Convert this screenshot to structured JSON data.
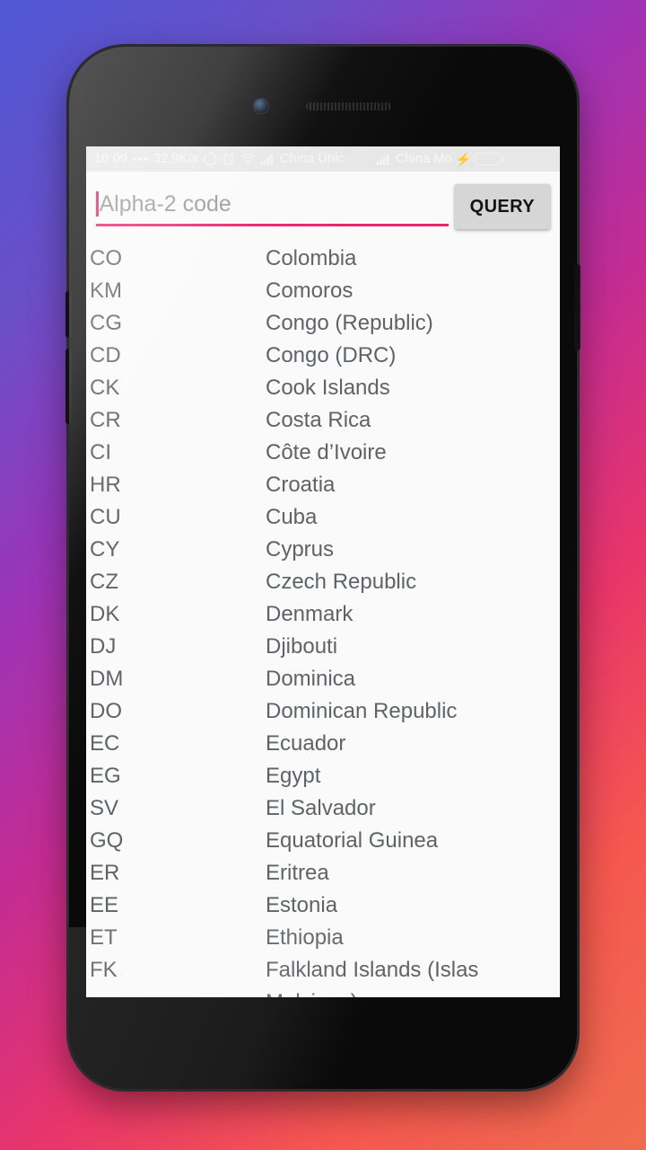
{
  "statusbar": {
    "time": "10:09",
    "dots": "•••",
    "network_speed": "32.9K/s",
    "sync_icon": "sync-icon",
    "alarm_icon": "alarm-clock-icon",
    "wifi_icon": "wifi-icon",
    "signal_icon_1": "signal-bars-icon",
    "carrier_1": "China Unic",
    "carrier_1_ellipsis": "···",
    "signal_icon_2": "signal-bars-icon",
    "carrier_2": "China Mo",
    "charging_icon": "charging-bolt-icon",
    "battery_icon": "battery-icon",
    "battery_color": "#25d135"
  },
  "search": {
    "placeholder": "Alpha-2 code",
    "value": "",
    "query_label": "QUERY",
    "accent_color": "#e8256f",
    "button_color": "#d6d6d6"
  },
  "list": {
    "rows": [
      {
        "code": "CO",
        "name": "Colombia"
      },
      {
        "code": "KM",
        "name": "Comoros"
      },
      {
        "code": "CG",
        "name": "Congo (Republic)"
      },
      {
        "code": "CD",
        "name": "Congo (DRC)"
      },
      {
        "code": "CK",
        "name": "Cook Islands"
      },
      {
        "code": "CR",
        "name": "Costa Rica"
      },
      {
        "code": "CI",
        "name": "Côte d’Ivoire"
      },
      {
        "code": "HR",
        "name": "Croatia"
      },
      {
        "code": "CU",
        "name": "Cuba"
      },
      {
        "code": "CY",
        "name": "Cyprus"
      },
      {
        "code": "CZ",
        "name": "Czech Republic"
      },
      {
        "code": "DK",
        "name": "Denmark"
      },
      {
        "code": "DJ",
        "name": "Djibouti"
      },
      {
        "code": "DM",
        "name": "Dominica"
      },
      {
        "code": "DO",
        "name": "Dominican Republic"
      },
      {
        "code": "EC",
        "name": "Ecuador"
      },
      {
        "code": "EG",
        "name": "Egypt"
      },
      {
        "code": "SV",
        "name": "El Salvador"
      },
      {
        "code": "GQ",
        "name": "Equatorial Guinea"
      },
      {
        "code": "ER",
        "name": "Eritrea"
      },
      {
        "code": "EE",
        "name": "Estonia"
      },
      {
        "code": "ET",
        "name": "Ethiopia"
      },
      {
        "code": "FK",
        "name": "Falkland Islands (Islas Malvinas)"
      }
    ]
  }
}
